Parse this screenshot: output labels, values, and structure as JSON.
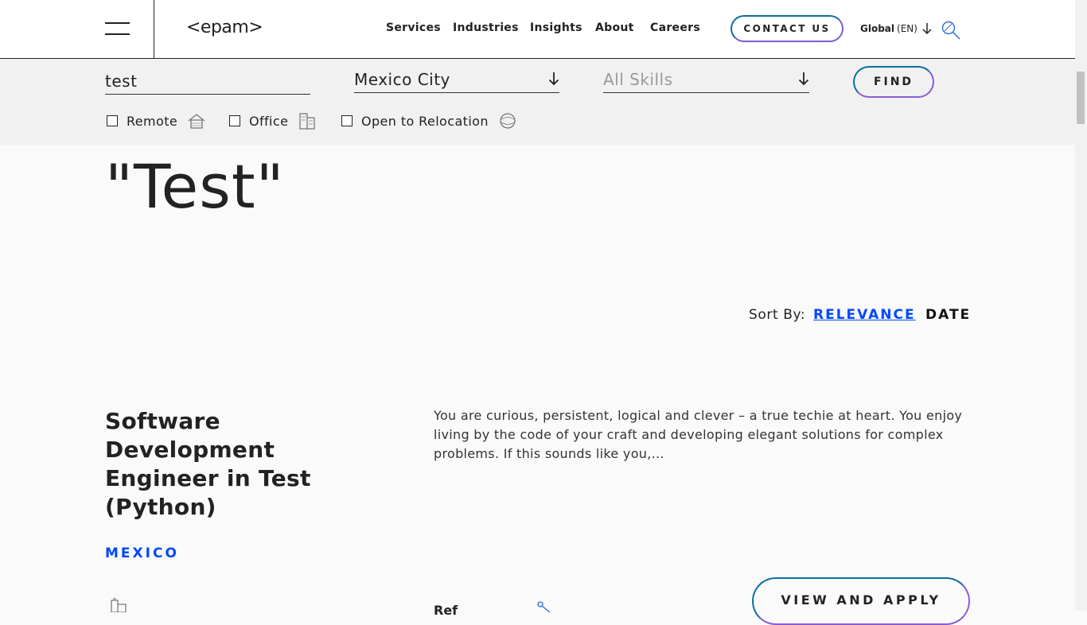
{
  "header": {
    "logo": "<epam>",
    "nav": [
      "Services",
      "Industries",
      "Insights",
      "About",
      "Careers"
    ],
    "contact_label": "CONTACT US",
    "global_label": "Global",
    "global_lang": "(EN)"
  },
  "filters": {
    "keyword_value": "test",
    "location_value": "Mexico City",
    "skills_placeholder": "All Skills",
    "find_label": "FIND",
    "checkboxes": [
      {
        "label": "Remote",
        "checked": false
      },
      {
        "label": "Office",
        "checked": false
      },
      {
        "label": "Open to Relocation",
        "checked": false
      }
    ]
  },
  "results": {
    "heading_test": "\"Test\""
  },
  "sort": {
    "label": "Sort By:",
    "relevance": "RELEVANCE",
    "date": "DATE"
  },
  "job": {
    "title": "Software Development Engineer in Test (Python)",
    "location": "MEXICO",
    "description": "You are curious, persistent, logical and clever – a true techie at heart. You enjoy living by the code of your craft and developing elegant solutions for complex problems. If this sounds like you,...",
    "apply_label": "VIEW AND APPLY",
    "meta_text": "Ref"
  },
  "colors": {
    "accent_blue": "#0047ff",
    "gradient_start": "#0d6ea0",
    "gradient_end": "#8a5cd6"
  }
}
